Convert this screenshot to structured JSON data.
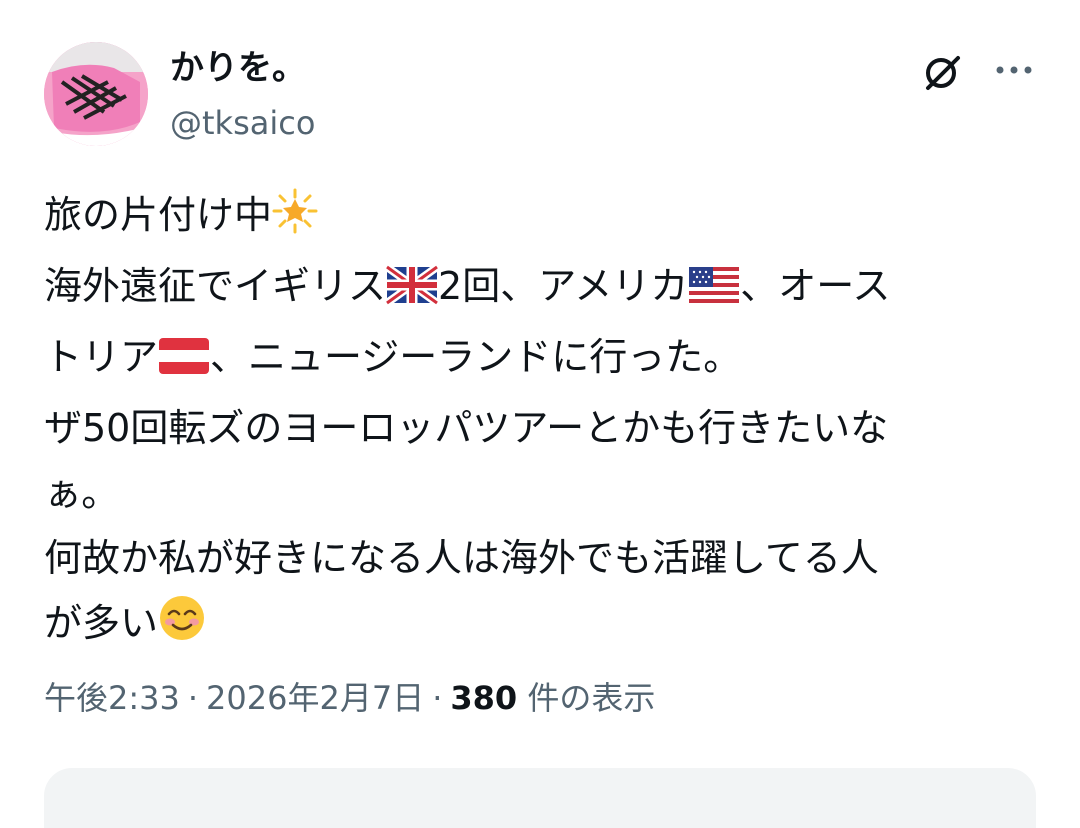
{
  "author": {
    "display_name": "かりを。",
    "handle": "@tksaico",
    "avatar_icon": "pink-sneaker-avatar"
  },
  "actions": {
    "grok_icon": "grok-slash-circle-icon",
    "more_icon": "more-horizontal-icon"
  },
  "tweet": {
    "lines": [
      "旅の片付け中",
      "海外遠征でイギリス",
      "2回、アメリカ",
      "、オース",
      "トリア",
      "、ニュージーランドに行った。",
      "ザ50回転ズのヨーロッパツアーとかも行きたいな",
      "ぁ。",
      "何故か私が好きになる人は海外でも活躍してる人",
      "が多い"
    ],
    "emoji": {
      "sun": "glowing-star-emoji",
      "uk": "uk-flag-emoji",
      "us": "us-flag-emoji",
      "austria": "austria-flag-emoji",
      "smile": "smiling-face-emoji"
    }
  },
  "meta": {
    "time": "午後2:33",
    "separator": "·",
    "date": "2026年2月7日",
    "views_count": "380",
    "views_label": "件の表示"
  },
  "colors": {
    "text": "#0f1419",
    "secondary": "#536471",
    "reply_bg": "#f2f4f5"
  }
}
